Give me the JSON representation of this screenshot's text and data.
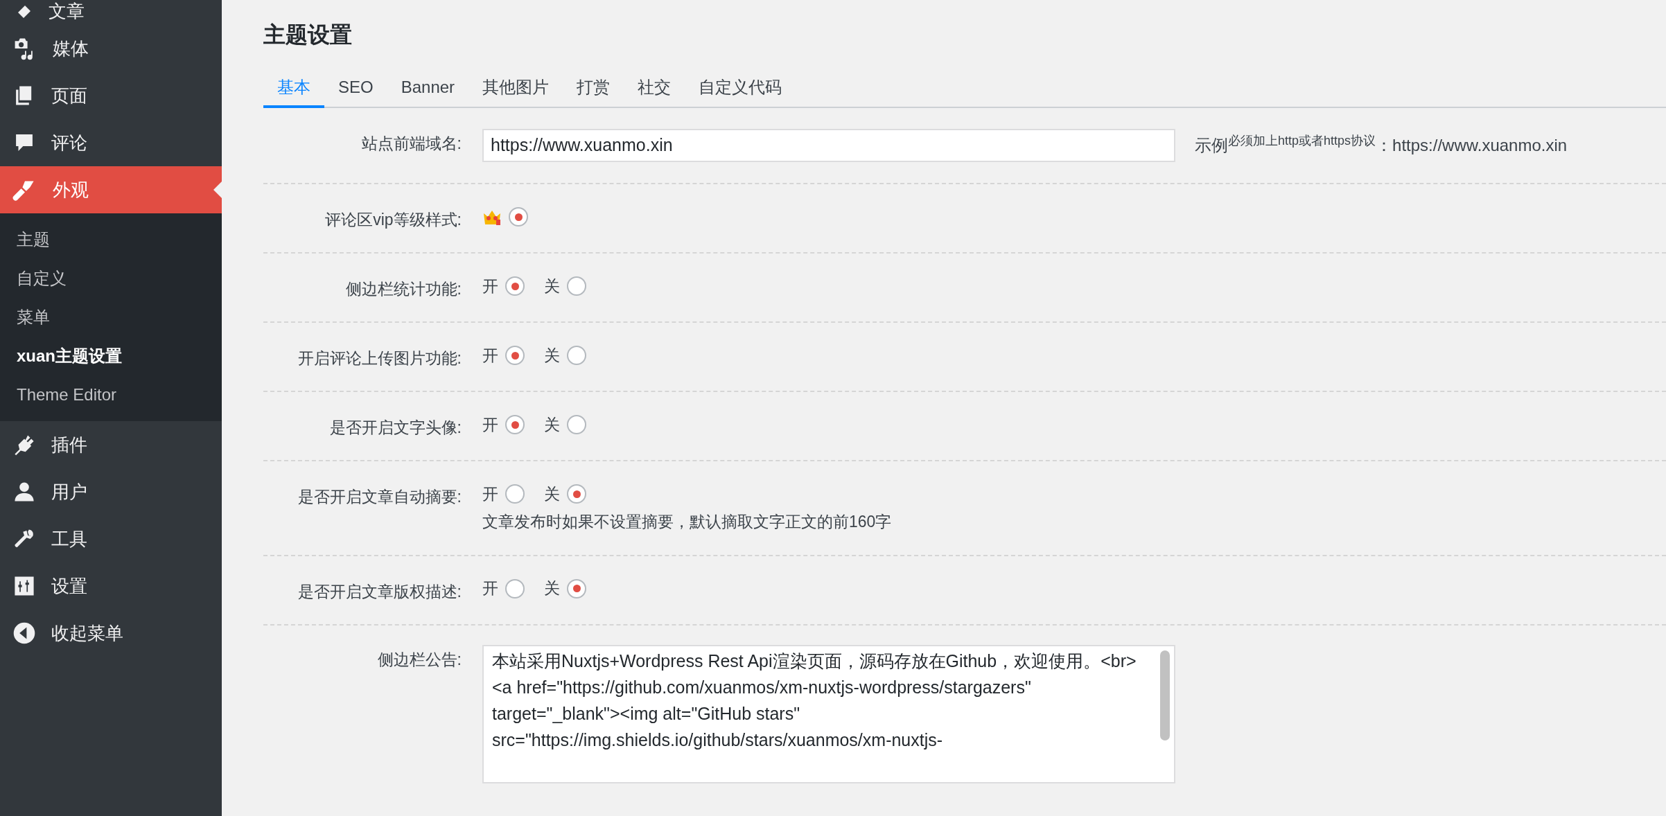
{
  "sidebar": {
    "items": [
      {
        "label": "文章",
        "selected": false
      },
      {
        "label": "媒体",
        "selected": false
      },
      {
        "label": "页面",
        "selected": false
      },
      {
        "label": "评论",
        "selected": false
      },
      {
        "label": "外观",
        "selected": true,
        "children": [
          {
            "label": "主题",
            "selected": false
          },
          {
            "label": "自定义",
            "selected": false
          },
          {
            "label": "菜单",
            "selected": false
          },
          {
            "label": "xuan主题设置",
            "selected": true
          },
          {
            "label": "Theme Editor",
            "selected": false
          }
        ]
      },
      {
        "label": "插件",
        "selected": false
      },
      {
        "label": "用户",
        "selected": false
      },
      {
        "label": "工具",
        "selected": false
      },
      {
        "label": "设置",
        "selected": false
      },
      {
        "label": "收起菜单",
        "selected": false
      }
    ]
  },
  "page": {
    "title": "主题设置"
  },
  "tabs": [
    {
      "label": "基本",
      "selected": true
    },
    {
      "label": "SEO",
      "selected": false
    },
    {
      "label": "Banner",
      "selected": false
    },
    {
      "label": "其他图片",
      "selected": false
    },
    {
      "label": "打赏",
      "selected": false
    },
    {
      "label": "社交",
      "selected": false
    },
    {
      "label": "自定义代码",
      "selected": false
    }
  ],
  "settings": [
    {
      "kind": "text",
      "label": "站点前端域名:",
      "value": "https://www.xuanmo.xin",
      "note": "示例$^{必须加上http或者https协议}$：https://www.xuanmo.xin"
    },
    {
      "kind": "radio",
      "label": "评论区vip等级样式:",
      "options": [
        {
          "kind": "icon",
          "selected": true
        }
      ]
    },
    {
      "kind": "radio",
      "label": "侧边栏统计功能:",
      "options": [
        {
          "label": "开",
          "selected": true
        },
        {
          "label": "关",
          "selected": false
        }
      ]
    },
    {
      "kind": "radio",
      "label": "开启评论上传图片功能:",
      "options": [
        {
          "label": "开",
          "selected": true
        },
        {
          "label": "关",
          "selected": false
        }
      ]
    },
    {
      "kind": "radio",
      "label": "是否开启文字头像:",
      "options": [
        {
          "label": "开",
          "selected": true
        },
        {
          "label": "关",
          "selected": false
        }
      ]
    },
    {
      "kind": "radio",
      "label": "是否开启文章自动摘要:",
      "options": [
        {
          "label": "开",
          "selected": false
        },
        {
          "label": "关",
          "selected": true
        }
      ],
      "description": "文章发布时如果不设置摘要，默认摘取文字正文的前160字"
    },
    {
      "kind": "radio",
      "label": "是否开启文章版权描述:",
      "options": [
        {
          "label": "开",
          "selected": false
        },
        {
          "label": "关",
          "selected": true
        }
      ]
    },
    {
      "kind": "textarea",
      "label": "侧边栏公告:",
      "value": "本站采用Nuxtjs+Wordpress Rest Api渲染页面，源码存放在Github，欢迎使用。<br>\n<a href=\"https://github.com/xuanmos/xm-nuxtjs-wordpress/stargazers\" target=\"_blank\"><img alt=\"GitHub stars\" src=\"https://img.shields.io/github/stars/xuanmos/xm-nuxtjs-"
    }
  ]
}
